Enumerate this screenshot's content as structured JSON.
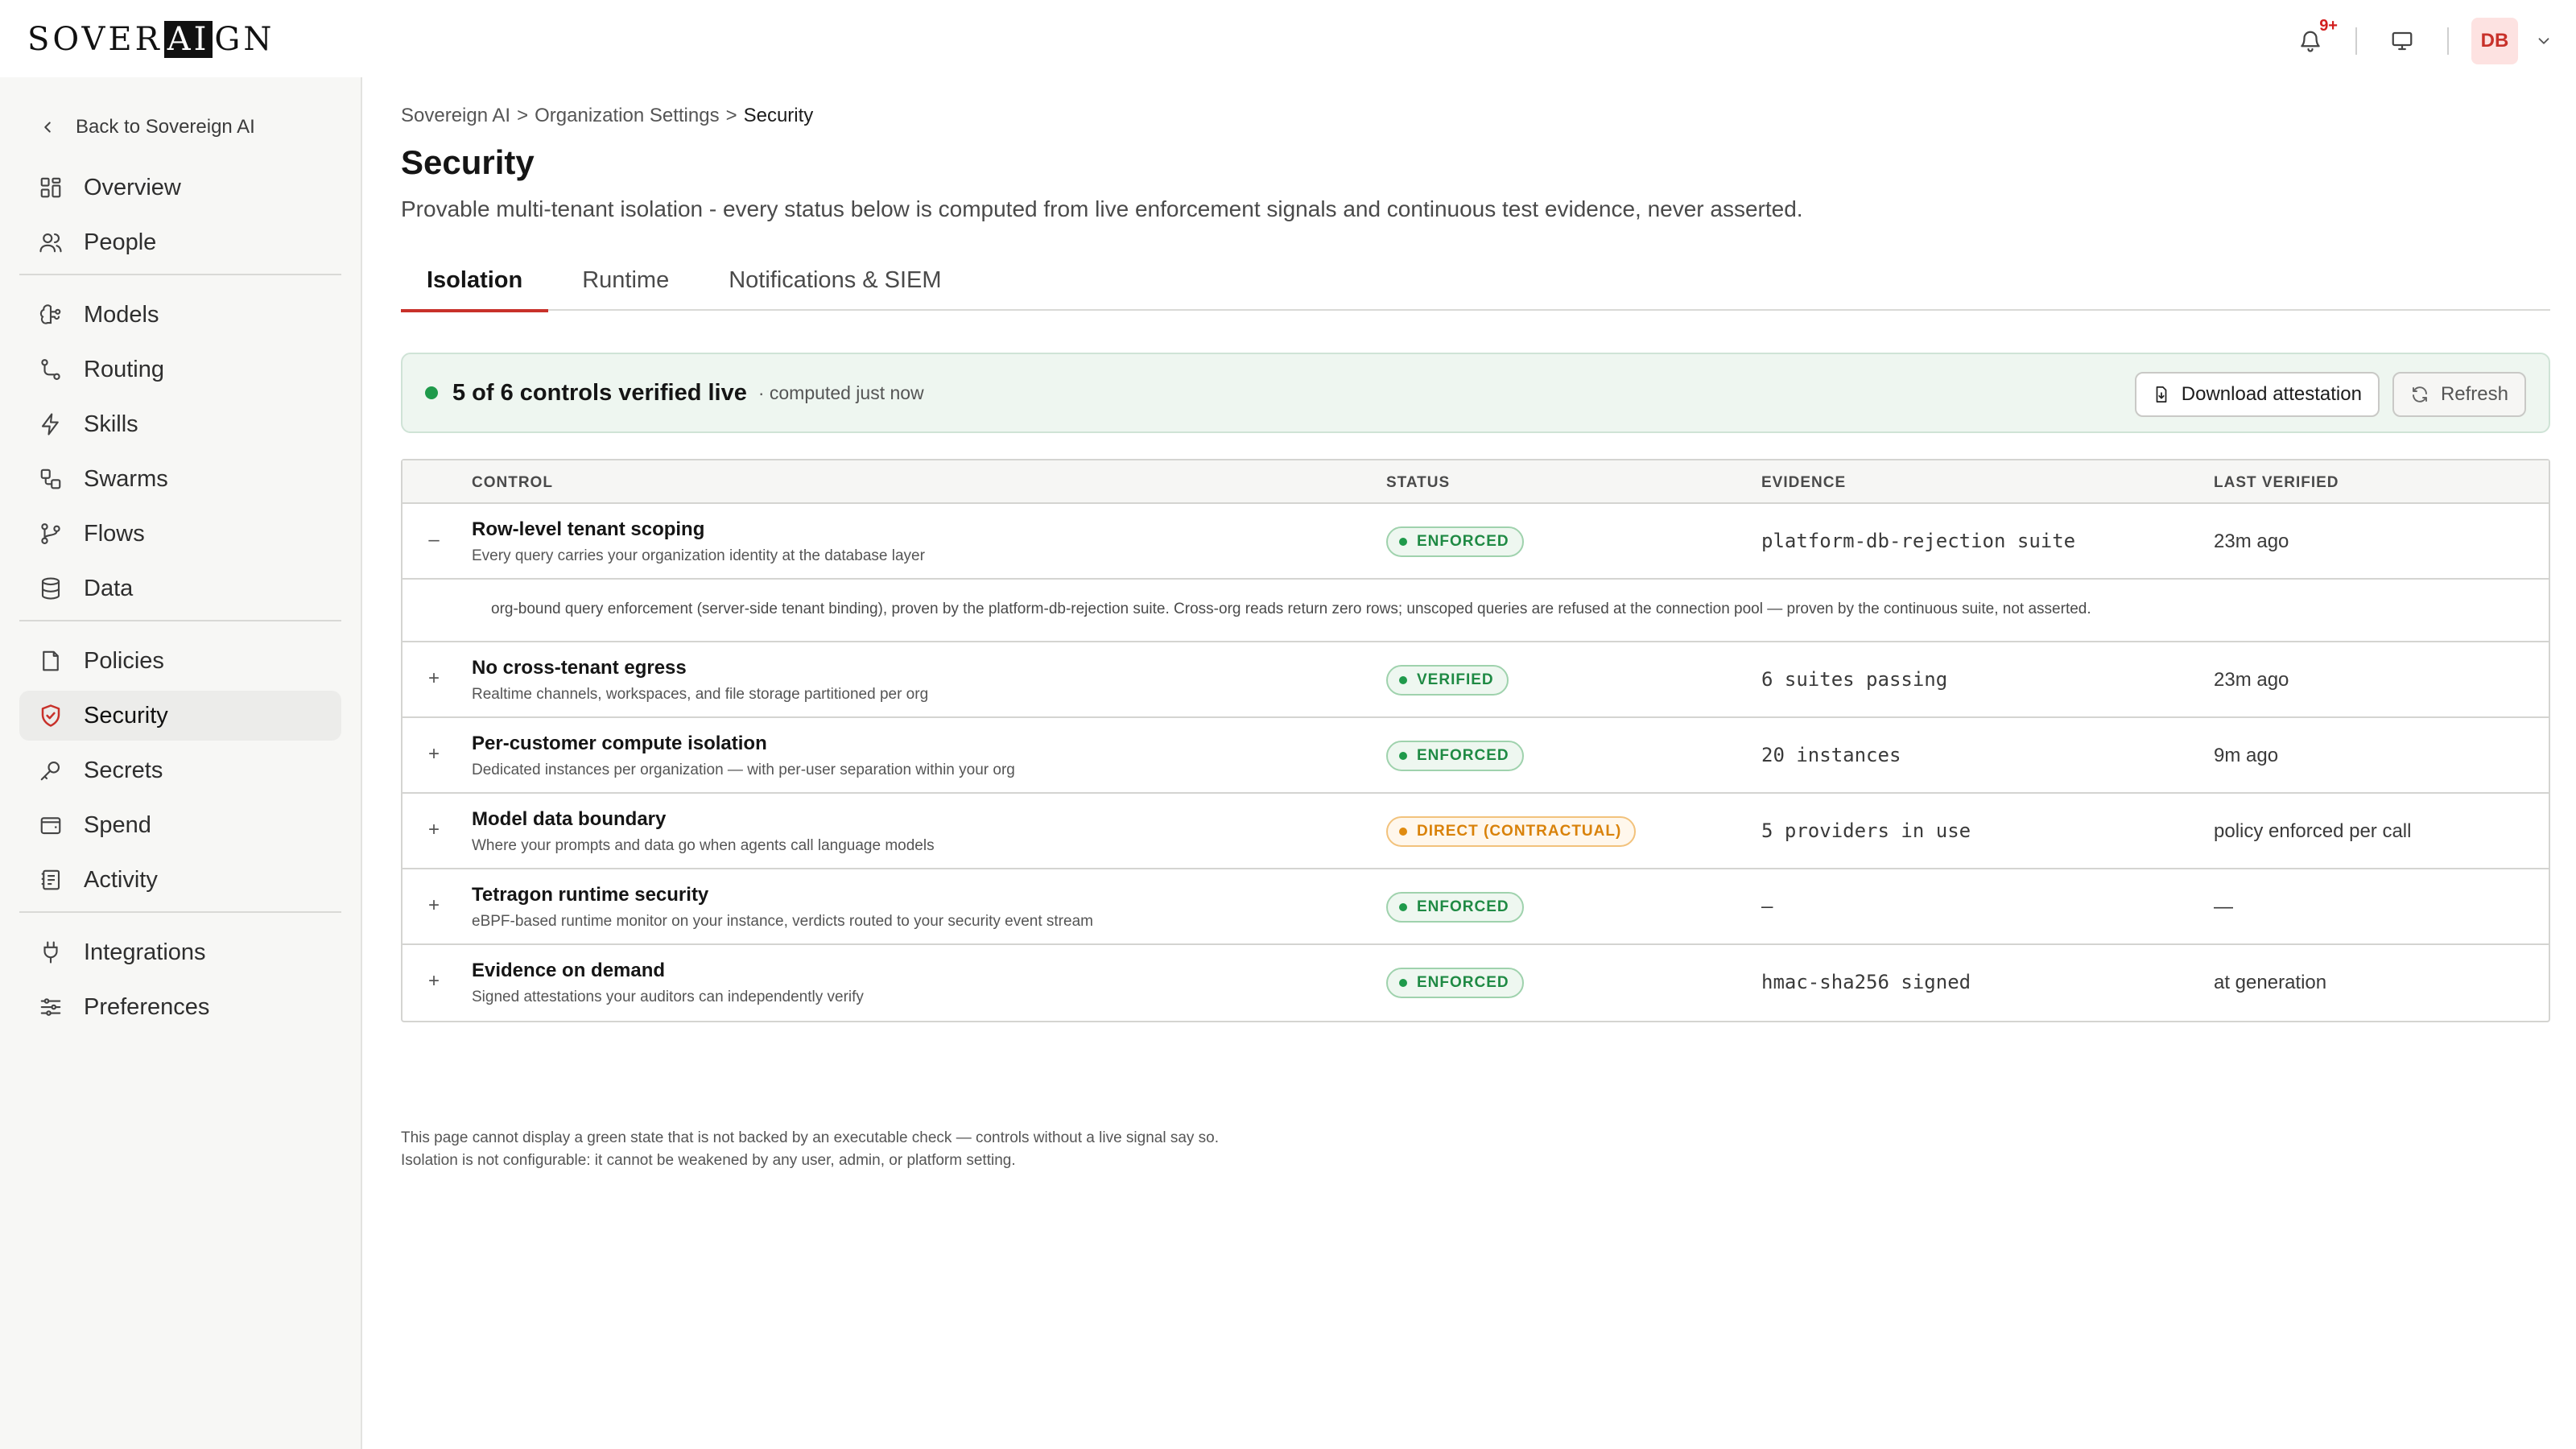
{
  "header": {
    "logo_pre": "SOVER",
    "logo_ai": "AI",
    "logo_post": "GN",
    "notifications_badge": "9+",
    "avatar_initials": "DB"
  },
  "sidebar": {
    "back_label": "Back to Sovereign AI",
    "items": [
      {
        "label": "Overview",
        "icon": "grid-icon"
      },
      {
        "label": "People",
        "icon": "people-icon"
      },
      {
        "label": "Models",
        "icon": "brain-icon"
      },
      {
        "label": "Routing",
        "icon": "route-icon"
      },
      {
        "label": "Skills",
        "icon": "bolt-icon"
      },
      {
        "label": "Swarms",
        "icon": "swarm-icon"
      },
      {
        "label": "Flows",
        "icon": "branch-icon"
      },
      {
        "label": "Data",
        "icon": "database-icon"
      },
      {
        "label": "Policies",
        "icon": "document-icon"
      },
      {
        "label": "Security",
        "icon": "shield-icon",
        "active": true
      },
      {
        "label": "Secrets",
        "icon": "key-icon"
      },
      {
        "label": "Spend",
        "icon": "wallet-icon"
      },
      {
        "label": "Activity",
        "icon": "activity-icon"
      },
      {
        "label": "Integrations",
        "icon": "plug-icon"
      },
      {
        "label": "Preferences",
        "icon": "sliders-icon"
      }
    ]
  },
  "breadcrumb": {
    "root": "Sovereign AI",
    "sep1": ">",
    "parent": "Organization Settings",
    "sep2": ">",
    "current": "Security"
  },
  "page": {
    "title": "Security",
    "subtitle": "Provable multi-tenant isolation - every status below is computed from live enforcement signals and continuous test evidence, never asserted."
  },
  "tabs": [
    "Isolation",
    "Runtime",
    "Notifications & SIEM"
  ],
  "summary": {
    "title": "5 of 6 controls verified live",
    "note": "· computed just now",
    "download_label": "Download attestation",
    "refresh_label": "Refresh"
  },
  "table": {
    "columns": [
      "CONTROL",
      "STATUS",
      "EVIDENCE",
      "LAST VERIFIED"
    ],
    "rows": [
      {
        "toggle": "–",
        "name": "Row-level tenant scoping",
        "desc": "Every query carries your organization identity at the database layer",
        "status": "ENFORCED",
        "status_color": "#1f8a44",
        "evidence": "platform-db-rejection suite",
        "verified": "23m ago"
      },
      {
        "toggle": "+",
        "name": "No cross-tenant egress",
        "desc": "Realtime channels, workspaces, and file storage partitioned per org",
        "status": "VERIFIED",
        "status_color": "#1f8a44",
        "evidence": "6 suites passing",
        "verified": "23m ago"
      },
      {
        "toggle": "+",
        "name": "Per-customer compute isolation",
        "desc": "Dedicated instances per organization — with per-user separation within your org",
        "status": "ENFORCED",
        "status_color": "#1f8a44",
        "evidence": "20 instances",
        "verified": "9m ago"
      },
      {
        "toggle": "+",
        "name": "Model data boundary",
        "desc": "Where your prompts and data go when agents call language models",
        "status": "DIRECT (CONTRACTUAL)",
        "status_color": "#d9820a",
        "evidence": "5 providers in use",
        "verified": "policy enforced per call"
      },
      {
        "toggle": "+",
        "name": "Tetragon runtime security",
        "desc": "eBPF-based runtime monitor on your instance, verdicts routed to your security event stream",
        "status": "ENFORCED",
        "status_color": "#1f8a44",
        "evidence": "–",
        "verified": "—"
      },
      {
        "toggle": "+",
        "name": "Evidence on demand",
        "desc": "Signed attestations your auditors can independently verify",
        "status": "ENFORCED",
        "status_color": "#1f8a44",
        "evidence": "hmac-sha256 signed",
        "verified": "at generation"
      }
    ],
    "expanded_detail": "org-bound query enforcement (server-side tenant binding), proven by the platform-db-rejection suite. Cross-org reads return zero rows; unscoped queries are refused at the connection pool — proven by the continuous suite, not asserted."
  },
  "footnote": {
    "line1": "This page cannot display a green state that is not backed by an executable check — controls without a live signal say so.",
    "line2": "Isolation is not configurable: it cannot be weakened by any user, admin, or platform setting."
  }
}
